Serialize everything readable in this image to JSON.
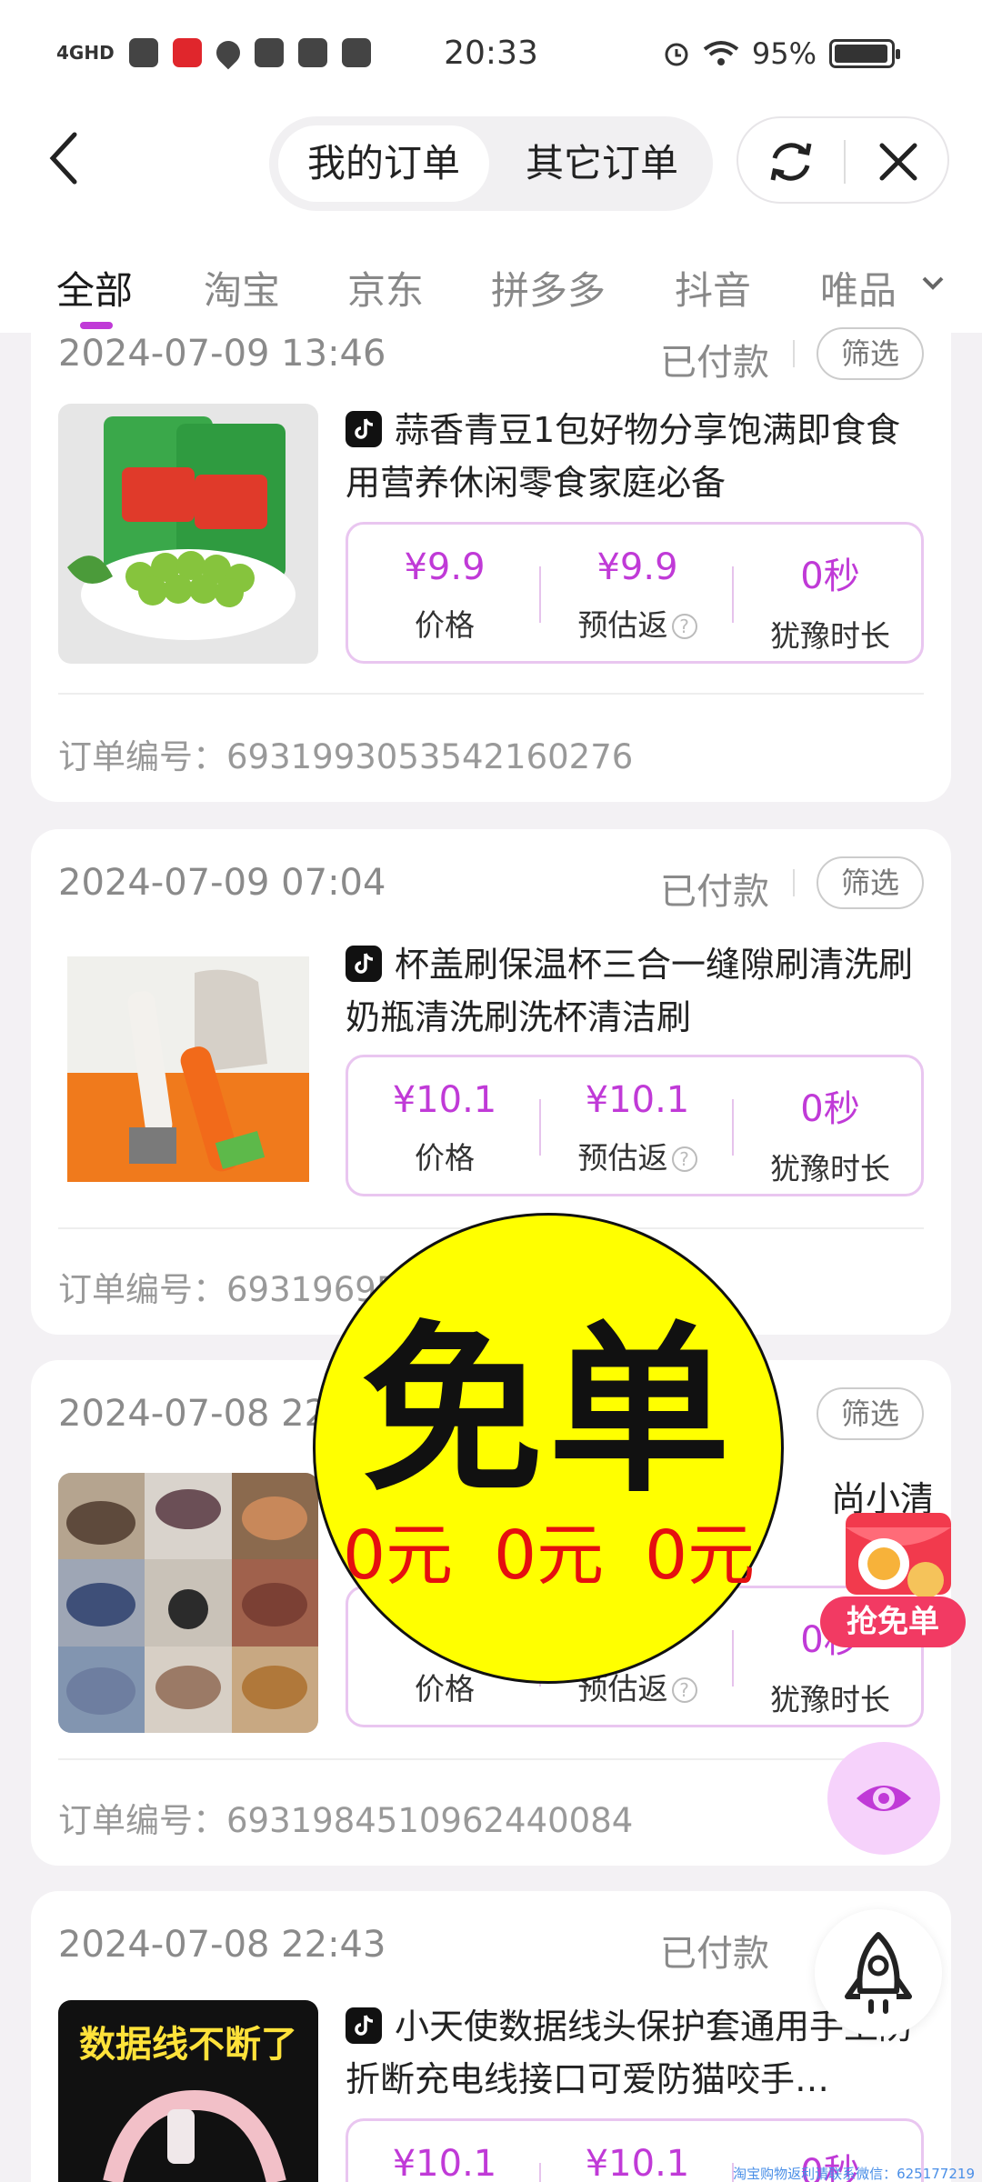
{
  "status_bar": {
    "time": "20:33",
    "network": "4GHD",
    "battery_percent": "95%",
    "battery_level": 0.95
  },
  "header": {
    "segments": [
      "我的订单",
      "其它订单"
    ],
    "active_segment": "我的订单"
  },
  "tabs": {
    "items": [
      "全部",
      "淘宝",
      "京东",
      "拼多多",
      "抖音",
      "唯品"
    ],
    "active": "全部"
  },
  "labels": {
    "price": "价格",
    "rebate": "预估返",
    "cooling": "犹豫时长",
    "status_paid": "已付款",
    "filter": "筛选",
    "order_no_prefix": "订单编号："
  },
  "orders": [
    {
      "datetime": "2024-07-09 13:46",
      "status": "已付款",
      "platform": "抖音",
      "title": "蒜香青豆1包好物分享饱满即食食用营养休闲零食家庭必备",
      "price": "¥9.9",
      "rebate": "¥9.9",
      "cooling": "0秒",
      "order_no": "6931993053542160276"
    },
    {
      "datetime": "2024-07-09 07:04",
      "status": "已付款",
      "platform": "抖音",
      "title": "杯盖刷保温杯三合一缝隙刷清洗刷奶瓶清洗刷洗杯清洁刷",
      "price": "¥10.1",
      "rebate": "¥10.1",
      "cooling": "0秒",
      "order_no": "69319695"
    },
    {
      "datetime": "2024-07-08 22",
      "title_fragment": "尚小清新",
      "cooling": "0秒",
      "order_no": "6931984510962440084"
    },
    {
      "datetime": "2024-07-08 22:43",
      "status": "已付款",
      "platform": "抖音",
      "title": "小天使数据线头保护套通用手上防折断充电线接口可爱防猫咬手…",
      "price": "¥10.1",
      "rebate": "¥10.1",
      "cooling": "0秒",
      "thumb_text": "数据线不断了"
    }
  ],
  "overlay": {
    "headline": "免单",
    "zeros": [
      "0元",
      "0元",
      "0元"
    ]
  },
  "floating": {
    "grab_free_label": "抢免单"
  },
  "watermark": "淘宝购物返利请联系微信：625177219",
  "colors": {
    "accent": "#c03ad7",
    "badge_yellow": "#ffff00",
    "badge_red": "#e50f0f"
  }
}
